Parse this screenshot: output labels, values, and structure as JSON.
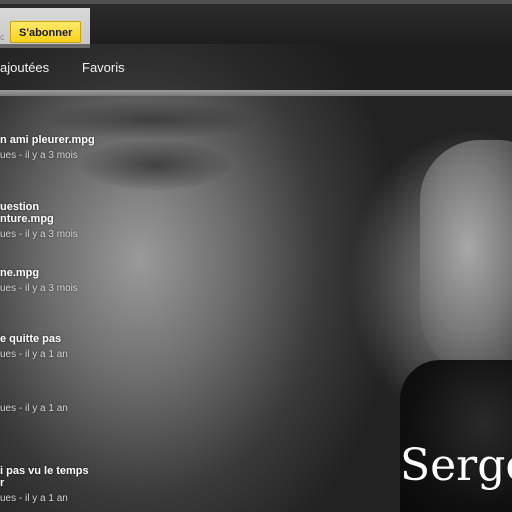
{
  "header": {
    "small_text": "c",
    "subscribe_label": "S'abonner"
  },
  "tabs": [
    {
      "label": "ajoutées"
    },
    {
      "label": "Favoris"
    }
  ],
  "videos": [
    {
      "title": "n ami pleurer.mpg",
      "meta": "ues - il y a 3 mois"
    },
    {
      "title": "uestion\nnture.mpg",
      "meta": "ues - il y a 3 mois"
    },
    {
      "title": "ne.mpg",
      "meta": "ues - il y a 3 mois"
    },
    {
      "title": "e quitte pas",
      "meta": "ues - il y a 1 an"
    },
    {
      "title": "",
      "meta": "ues - il y a 1 an"
    },
    {
      "title": "i pas vu le temps\nr",
      "meta": "ues - il y a 1 an"
    }
  ],
  "banner": {
    "name": "Serge"
  },
  "colors": {
    "subscribe_bg": "#f7d21a",
    "tab_text": "#f2f2f2",
    "separator": "#8a8a8a"
  }
}
